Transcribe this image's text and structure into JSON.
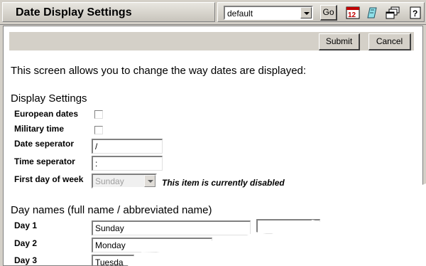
{
  "window": {
    "title": "Date Display Settings"
  },
  "toolbar": {
    "profile_select": "default",
    "go_label": "Go",
    "icons": [
      "calendar-12-icon",
      "stamp-icon",
      "windows-icon",
      "help-icon"
    ]
  },
  "actions": {
    "submit_label": "Submit",
    "cancel_label": "Cancel"
  },
  "intro": "This screen allows you to change the way dates are displayed:",
  "display_settings": {
    "heading": "Display Settings",
    "european_dates_label": "European dates",
    "european_dates_checked": false,
    "military_time_label": "Military time",
    "military_time_checked": false,
    "date_separator_label": "Date seperator",
    "date_separator_value": "/",
    "time_separator_label": "Time seperator",
    "time_separator_value": ":",
    "first_day_label": "First day of week",
    "first_day_value": "Sunday",
    "first_day_disabled_note": "This item is currently disabled"
  },
  "day_names": {
    "heading": "Day names (full name / abbreviated name)",
    "days": [
      {
        "label": "Day 1",
        "full": "Sunday"
      },
      {
        "label": "Day 2",
        "full": "Monday"
      },
      {
        "label": "Day 3",
        "full": "Tuesda"
      }
    ]
  }
}
